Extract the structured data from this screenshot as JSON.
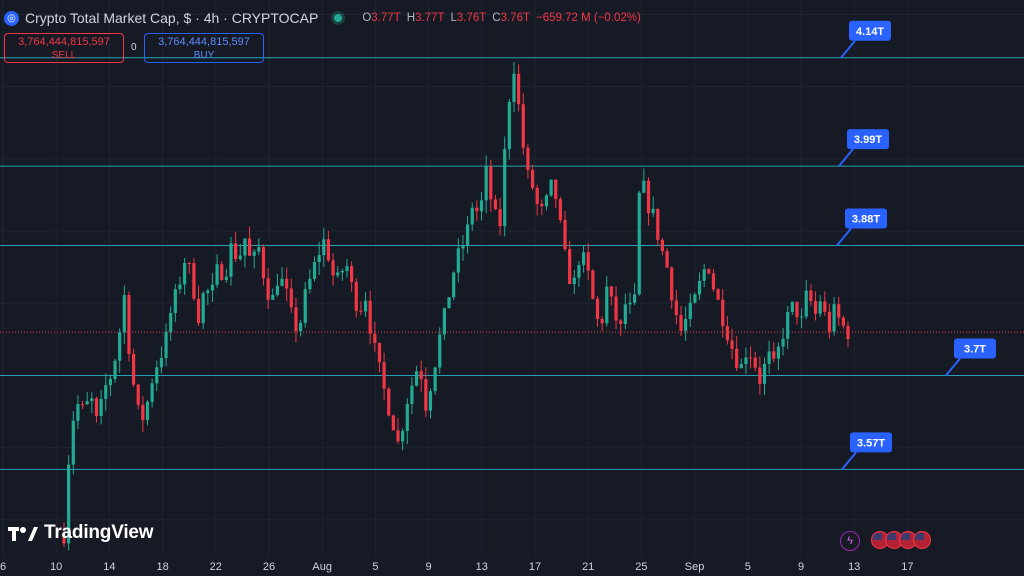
{
  "header": {
    "symbol_icon": "crypto-logo-icon",
    "title": "Crypto Total Market Cap, $ · 4h · CRYPTOCAP",
    "ohlc": [
      {
        "k": "O",
        "v": "3.77T"
      },
      {
        "k": "H",
        "v": "3.77T"
      },
      {
        "k": "L",
        "v": "3.76T"
      },
      {
        "k": "C",
        "v": "3.76T"
      }
    ],
    "change": "−659.72 M (−0.02%)"
  },
  "trade": {
    "sell_price": "3,764,444,815,597",
    "sell_label": "SELL",
    "spread": "0",
    "buy_price": "3,764,444,815,597",
    "buy_label": "BUY"
  },
  "branding": {
    "logo_text": "TradingView"
  },
  "colors": {
    "background": "#161a25",
    "up": "#22ab94",
    "down": "#f23645",
    "level_line": "#26a0b5",
    "label_bg": "#2962ff"
  },
  "chart_data": {
    "type": "candlestick",
    "y_unit": "T",
    "ylim": [
      3.45,
      4.22
    ],
    "x_ticks": [
      "6",
      "10",
      "14",
      "18",
      "22",
      "26",
      "Aug",
      "5",
      "9",
      "13",
      "17",
      "21",
      "25",
      "Sep",
      "5",
      "9",
      "13",
      "17"
    ],
    "levels": [
      {
        "value": 4.14,
        "label": "4.14T"
      },
      {
        "value": 3.99,
        "label": "3.99T"
      },
      {
        "value": 3.88,
        "label": "3.88T"
      },
      {
        "value": 3.7,
        "label": "3.7T"
      },
      {
        "value": 3.57,
        "label": "3.57T"
      }
    ],
    "current_price": 3.76,
    "close_path": [
      3.48,
      3.63,
      3.66,
      3.65,
      3.67,
      3.63,
      3.68,
      3.7,
      3.74,
      3.81,
      3.71,
      3.65,
      3.64,
      3.69,
      3.72,
      3.74,
      3.79,
      3.82,
      3.86,
      3.84,
      3.78,
      3.82,
      3.81,
      3.85,
      3.84,
      3.88,
      3.86,
      3.89,
      3.85,
      3.88,
      3.83,
      3.8,
      3.84,
      3.82,
      3.78,
      3.76,
      3.81,
      3.84,
      3.87,
      3.89,
      3.84,
      3.83,
      3.86,
      3.82,
      3.79,
      3.81,
      3.75,
      3.71,
      3.67,
      3.64,
      3.6,
      3.66,
      3.69,
      3.72,
      3.66,
      3.7,
      3.75,
      3.79,
      3.84,
      3.87,
      3.89,
      3.94,
      3.92,
      3.98,
      3.93,
      3.9,
      4.04,
      4.14,
      4.06,
      3.98,
      3.96,
      3.92,
      3.94,
      3.97,
      3.91,
      3.85,
      3.82,
      3.87,
      3.85,
      3.8,
      3.76,
      3.82,
      3.79,
      3.76,
      3.81,
      3.77,
      3.98,
      3.94,
      3.92,
      3.88,
      3.85,
      3.8,
      3.76,
      3.78,
      3.8,
      3.83,
      3.86,
      3.82,
      3.79,
      3.76,
      3.73,
      3.71,
      3.74,
      3.72,
      3.69,
      3.73,
      3.71,
      3.75,
      3.78,
      3.8,
      3.77,
      3.82,
      3.78,
      3.81,
      3.76,
      3.79,
      3.77,
      3.76
    ]
  }
}
